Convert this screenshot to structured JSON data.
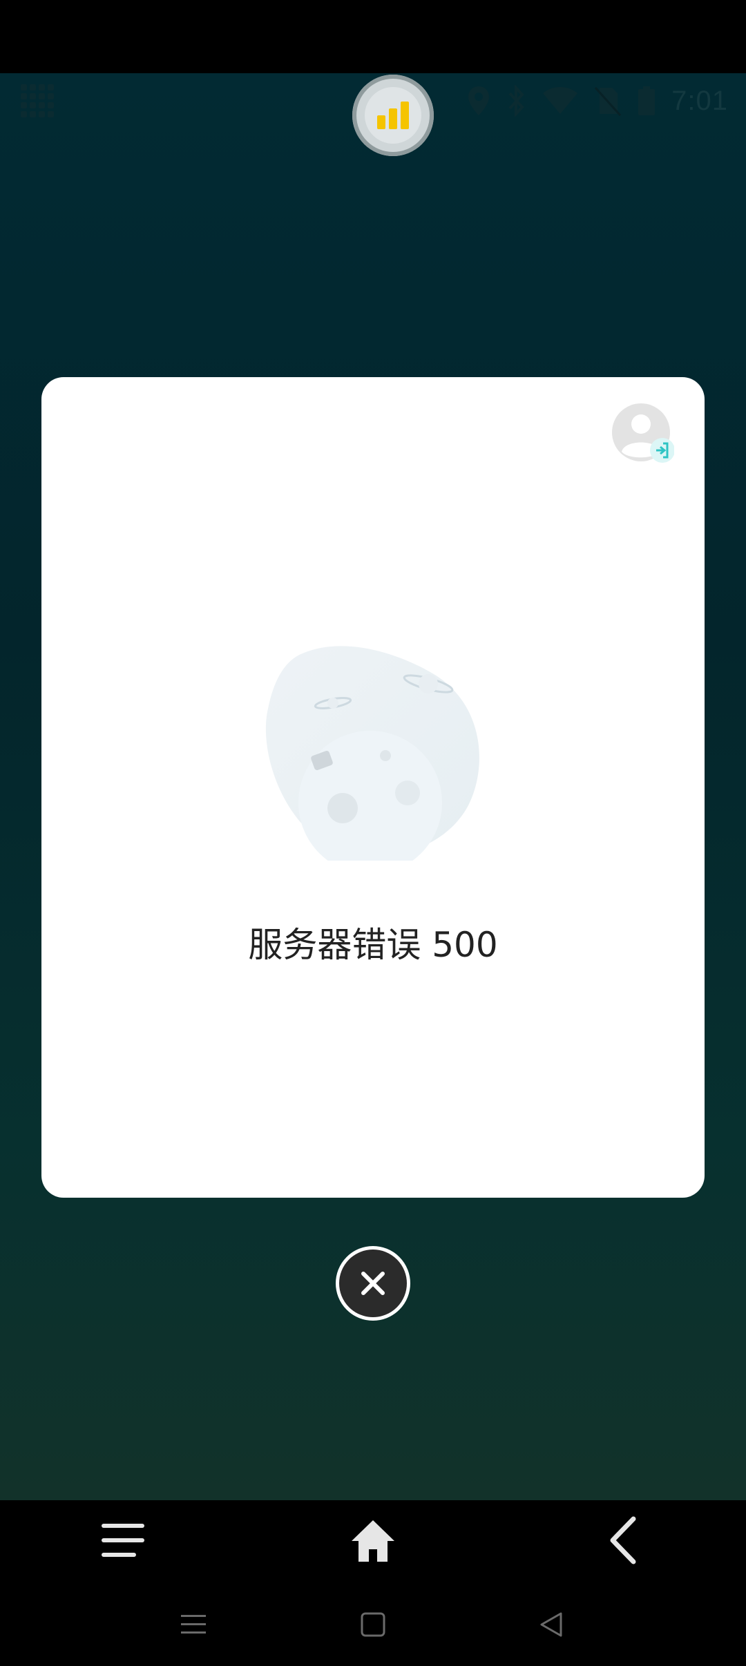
{
  "status_bar": {
    "time": "7:01",
    "icons": [
      "app-grid-icon",
      "location-icon",
      "bluetooth-icon",
      "wifi-icon",
      "no-sim-icon",
      "battery-icon"
    ]
  },
  "floating_bubble": {
    "icon": "bar-chart-icon",
    "accent_color": "#f5c400"
  },
  "dialog": {
    "login_icon": "user-login-icon",
    "illustration": "planet-illustration",
    "error_message": "服务器错误 500"
  },
  "close_button": {
    "icon": "close-icon"
  },
  "app_bar": {
    "items": [
      "menu-icon",
      "home-icon",
      "back-icon"
    ]
  },
  "system_nav": {
    "items": [
      "recents-icon",
      "home-square-icon",
      "back-triangle-icon"
    ]
  },
  "colors": {
    "backdrop": "#022a33",
    "dialog_bg": "#ffffff",
    "login_accent": "#2ec4c4"
  }
}
